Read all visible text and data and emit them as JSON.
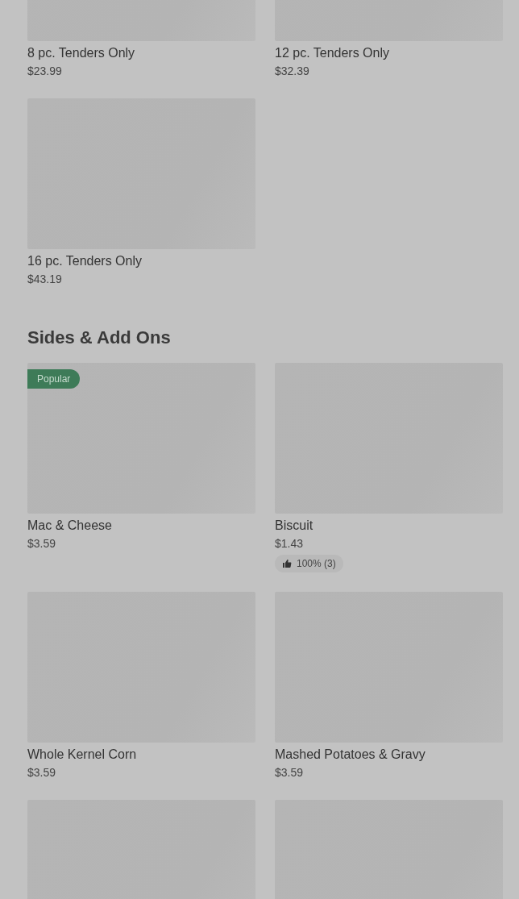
{
  "sections": [
    {
      "items": [
        {
          "kind": "product",
          "name": "8 pc. Tenders Only",
          "price": "$23.99"
        },
        {
          "kind": "product",
          "name": "12 pc. Tenders Only",
          "price": "$32.39"
        },
        {
          "kind": "product",
          "name": "16 pc. Tenders Only",
          "price": "$43.19"
        }
      ]
    },
    {
      "title": "Sides & Add Ons",
      "items": [
        {
          "kind": "product",
          "name": "Mac & Cheese",
          "price": "$3.59",
          "badge": "Popular"
        },
        {
          "kind": "product",
          "name": "Biscuit",
          "price": "$1.43",
          "rating": "100% (3)"
        },
        {
          "kind": "product",
          "name": "Whole Kernel Corn",
          "price": "$3.59"
        },
        {
          "kind": "product",
          "name": "Mashed Potatoes & Gravy",
          "price": "$3.59"
        },
        {
          "kind": "image-only"
        },
        {
          "kind": "image-only"
        }
      ]
    }
  ]
}
